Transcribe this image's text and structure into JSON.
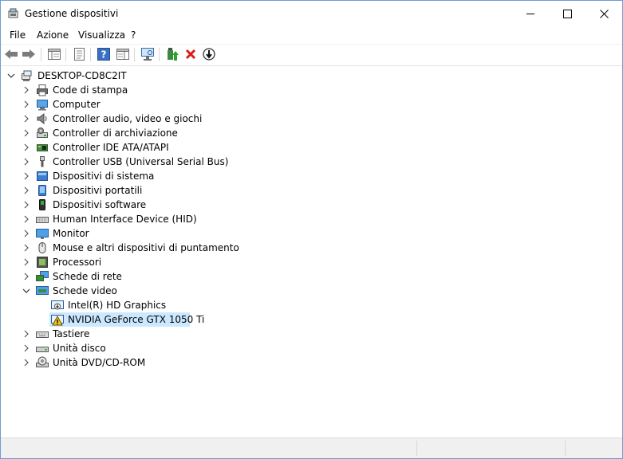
{
  "window": {
    "title": "Gestione dispositivi"
  },
  "menu": {
    "items": [
      "File",
      "Azione",
      "Visualizza",
      "?"
    ]
  },
  "toolbar": {
    "buttons": [
      "back-icon",
      "forward-icon",
      "show-hide-tree-icon",
      "properties-icon",
      "help-icon",
      "action-pane-icon",
      "scan-hardware-icon",
      "update-driver-icon",
      "uninstall-device-icon",
      "disable-device-icon"
    ]
  },
  "tree": {
    "root": "DESKTOP-CD8C2IT",
    "categories": [
      "Code di stampa",
      "Computer",
      "Controller audio, video e giochi",
      "Controller di archiviazione",
      "Controller IDE ATA/ATAPI",
      "Controller USB (Universal Serial Bus)",
      "Dispositivi di sistema",
      "Dispositivi portatili",
      "Dispositivi software",
      "Human Interface Device (HID)",
      "Monitor",
      "Mouse e altri dispositivi di puntamento",
      "Processori",
      "Schede di rete",
      "Schede video",
      "Tastiere",
      "Unità disco",
      "Unità DVD/CD-ROM"
    ],
    "video_children": [
      "Intel(R) HD Graphics",
      "NVIDIA GeForce GTX 1050 Ti"
    ],
    "selected": "NVIDIA GeForce GTX 1050 Ti"
  }
}
